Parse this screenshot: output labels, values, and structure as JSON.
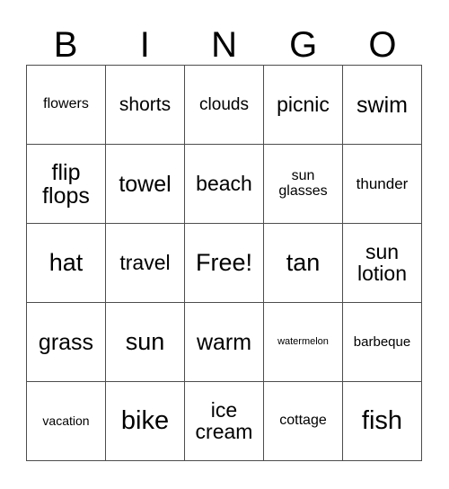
{
  "card": {
    "title": "BINGO",
    "header_letters": [
      "B",
      "I",
      "N",
      "G",
      "O"
    ],
    "free_space_label": "Free!",
    "colors": {
      "background": "#ffffff",
      "text": "#000000",
      "grid_line": "#4d4d4d"
    },
    "grid": {
      "columns": 5,
      "rows": 5,
      "cells": [
        [
          {
            "text": "flowers",
            "size": "md"
          },
          {
            "text": "shorts",
            "size": "xl"
          },
          {
            "text": "clouds",
            "size": "lg"
          },
          {
            "text": "picnic",
            "size": "2xl"
          },
          {
            "text": "swim",
            "size": "3xl"
          }
        ],
        [
          {
            "text": "flip\nflops",
            "size": "3xl"
          },
          {
            "text": "towel",
            "size": "3xl"
          },
          {
            "text": "beach",
            "size": "2xl"
          },
          {
            "text": "sun\nglasses",
            "size": "md"
          },
          {
            "text": "thunder",
            "size": "mdl"
          }
        ],
        [
          {
            "text": "hat",
            "size": "4xl"
          },
          {
            "text": "travel",
            "size": "2xl"
          },
          {
            "text": "Free!",
            "size": "4xl"
          },
          {
            "text": "tan",
            "size": "4xl"
          },
          {
            "text": "sun\nlotion",
            "size": "2xl"
          }
        ],
        [
          {
            "text": "grass",
            "size": "3xl"
          },
          {
            "text": "sun",
            "size": "4xl"
          },
          {
            "text": "warm",
            "size": "3xl"
          },
          {
            "text": "watermelon",
            "size": "xs"
          },
          {
            "text": "barbeque",
            "size": "smd"
          }
        ],
        [
          {
            "text": "vacation",
            "size": "sm"
          },
          {
            "text": "bike",
            "size": "5xl"
          },
          {
            "text": "ice\ncream",
            "size": "2xl"
          },
          {
            "text": "cottage",
            "size": "md"
          },
          {
            "text": "fish",
            "size": "5xl"
          }
        ]
      ]
    }
  }
}
